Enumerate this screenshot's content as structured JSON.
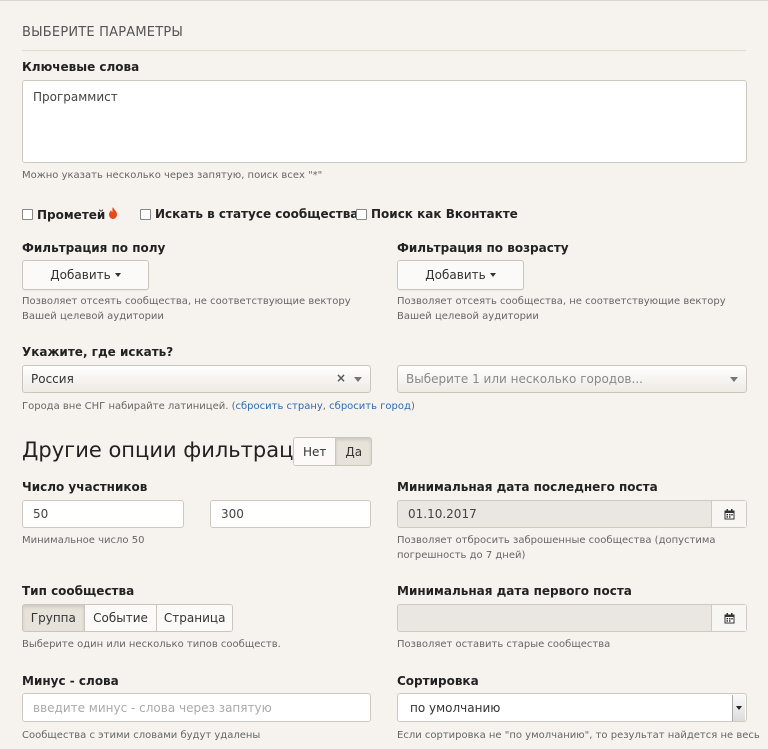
{
  "section_title": "ВЫБЕРИТЕ ПАРАМЕТРЫ",
  "keywords": {
    "label": "Ключевые слова",
    "value": "Программист",
    "hint": "Можно указать несколько через запятую, поиск всех \"*\""
  },
  "checkboxes": {
    "prometheus": "Прометей",
    "status": "Искать в статусе сообщества",
    "vk_search": "Поиск как Вконтакте"
  },
  "gender_filter": {
    "label": "Фильтрация по полу",
    "button": "Добавить",
    "hint": "Позволяет отсеять сообщества, не соответствующие вектору Вашей целевой аудитории"
  },
  "age_filter": {
    "label": "Фильтрация по возрасту",
    "button": "Добавить",
    "hint": "Позволяет отсеять сообщества, не соответствующие вектору Вашей целевой аудитории"
  },
  "location": {
    "label": "Укажите, где искать?",
    "country": "Россия",
    "clear": "×",
    "city_placeholder": "Выберите 1 или несколько городов...",
    "hint_prefix": "Города вне СНГ набирайте латиницей. (",
    "reset_country": "сбросить страну",
    "separator": ", ",
    "reset_city": "сбросить город",
    "hint_suffix": ")"
  },
  "other_options": {
    "title": "Другие опции фильтрации",
    "no": "Нет",
    "yes": "Да",
    "selected": "yes"
  },
  "members": {
    "label": "Число участников",
    "min": "50",
    "max": "300",
    "hint": "Минимальное число 50"
  },
  "last_post": {
    "label": "Минимальная дата последнего поста",
    "value": "01.10.2017",
    "hint": "Позволяет отбросить заброшенные сообщества (допустима погрешность до 7 дней)"
  },
  "community_type": {
    "label": "Тип сообщества",
    "options": [
      "Группа",
      "Событие",
      "Страница"
    ],
    "active": "Группа",
    "hint": "Выберите один или несколько типов сообществ."
  },
  "first_post": {
    "label": "Минимальная дата первого поста",
    "value": "",
    "hint": "Позволяет оставить старые сообщества"
  },
  "minus_words": {
    "label": "Минус - слова",
    "placeholder": "введите минус - слова через запятую",
    "hint": "Сообщества с этими словами будут удалены"
  },
  "sorting": {
    "label": "Сортировка",
    "value": "по умолчанию",
    "hint": "Если сортировка не \"по умолчанию\", то результат найдется не весь"
  },
  "icons": {
    "fire": "fire-icon",
    "calendar": "calendar-icon",
    "caret": "caret-down-icon"
  }
}
